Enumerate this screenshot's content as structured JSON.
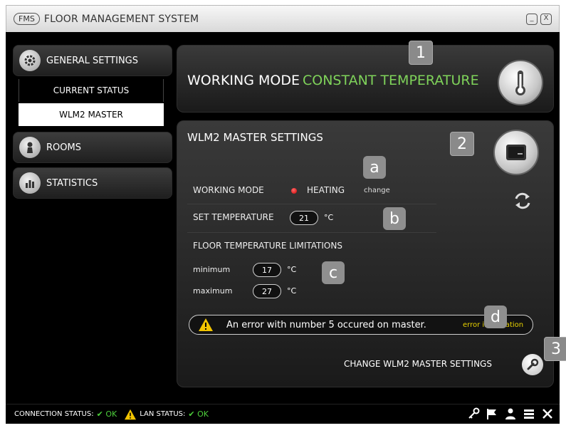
{
  "window": {
    "badge": "FMS",
    "title": "FLOOR MANAGEMENT SYSTEM",
    "minimize_glyph": "_",
    "close_glyph": "X"
  },
  "sidebar": {
    "items": [
      {
        "label": "GENERAL SETTINGS",
        "icon": "gear-icon"
      },
      {
        "label": "ROOMS",
        "icon": "person-icon"
      },
      {
        "label": "STATISTICS",
        "icon": "bar-chart-icon"
      }
    ],
    "subitems": [
      {
        "label": "CURRENT STATUS"
      },
      {
        "label": "WLM2 MASTER",
        "active": true
      }
    ]
  },
  "working_mode_panel": {
    "label": "WORKING MODE",
    "value": "CONSTANT TEMPERATURE",
    "value_color": "#7fd35a",
    "marker": "1",
    "icon": "thermometer-icon"
  },
  "master_panel": {
    "title": "WLM2 MASTER SETTINGS",
    "marker": "2",
    "device_icon": "device-icon",
    "sync_icon": "sync-icon",
    "working_mode": {
      "label": "WORKING MODE",
      "value": "HEATING",
      "indicator_color": "#e00000",
      "change_link": "change",
      "marker": "a"
    },
    "set_temperature": {
      "label": "SET TEMPERATURE",
      "value": "21",
      "unit": "°C",
      "marker": "b"
    },
    "floor_limits": {
      "label": "FLOOR TEMPERATURE LIMITATIONS",
      "minimum": {
        "label": "minimum",
        "value": "17",
        "unit": "°C"
      },
      "maximum": {
        "label": "maximum",
        "value": "27",
        "unit": "°C"
      },
      "marker": "c"
    },
    "error": {
      "message": "An error with number 5 occured on master.",
      "link": "error information",
      "marker": "d"
    },
    "change_settings": {
      "label": "CHANGE WLM2 MASTER SETTINGS",
      "marker": "3"
    }
  },
  "statusbar": {
    "connection_label": "CONNECTION STATUS:",
    "connection_value": "OK",
    "lan_label": "LAN STATUS:",
    "lan_value": "OK",
    "ok_color": "#4ccc3a",
    "icons": [
      "key-icon",
      "flag-icon",
      "user-icon",
      "list-icon",
      "tools-icon"
    ]
  }
}
